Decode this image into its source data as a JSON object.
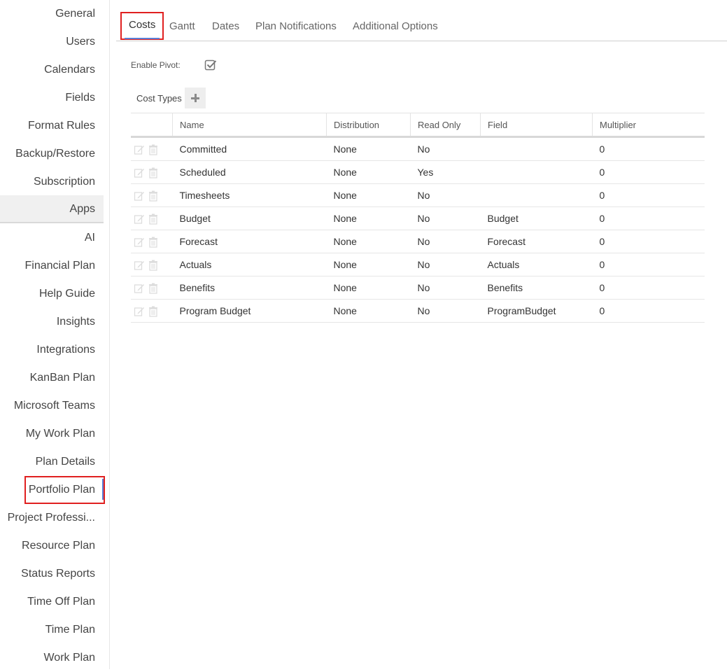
{
  "sidebar": {
    "items": [
      {
        "label": "General"
      },
      {
        "label": "Users"
      },
      {
        "label": "Calendars"
      },
      {
        "label": "Fields"
      },
      {
        "label": "Format Rules"
      },
      {
        "label": "Backup/Restore"
      },
      {
        "label": "Subscription"
      },
      {
        "label": "Apps"
      },
      {
        "label": "AI"
      },
      {
        "label": "Financial Plan"
      },
      {
        "label": "Help Guide"
      },
      {
        "label": "Insights"
      },
      {
        "label": "Integrations"
      },
      {
        "label": "KanBan Plan"
      },
      {
        "label": "Microsoft Teams"
      },
      {
        "label": "My Work Plan"
      },
      {
        "label": "Plan Details"
      },
      {
        "label": "Portfolio Plan"
      },
      {
        "label": "Project Professi..."
      },
      {
        "label": "Resource Plan"
      },
      {
        "label": "Status Reports"
      },
      {
        "label": "Time Off Plan"
      },
      {
        "label": "Time Plan"
      },
      {
        "label": "Work Plan"
      }
    ]
  },
  "tabs": [
    {
      "label": "Costs"
    },
    {
      "label": "Gantt"
    },
    {
      "label": "Dates"
    },
    {
      "label": "Plan Notifications"
    },
    {
      "label": "Additional Options"
    }
  ],
  "pivot": {
    "label": "Enable Pivot:",
    "checked": true
  },
  "cost_types": {
    "label": "Cost Types",
    "columns": [
      "Name",
      "Distribution",
      "Read Only",
      "Field",
      "Multiplier"
    ],
    "rows": [
      {
        "name": "Committed",
        "distribution": "None",
        "read_only": "No",
        "field": "",
        "multiplier": "0"
      },
      {
        "name": "Scheduled",
        "distribution": "None",
        "read_only": "Yes",
        "field": "",
        "multiplier": "0"
      },
      {
        "name": "Timesheets",
        "distribution": "None",
        "read_only": "No",
        "field": "",
        "multiplier": "0"
      },
      {
        "name": "Budget",
        "distribution": "None",
        "read_only": "No",
        "field": "Budget",
        "multiplier": "0"
      },
      {
        "name": "Forecast",
        "distribution": "None",
        "read_only": "No",
        "field": "Forecast",
        "multiplier": "0"
      },
      {
        "name": "Actuals",
        "distribution": "None",
        "read_only": "No",
        "field": "Actuals",
        "multiplier": "0"
      },
      {
        "name": "Benefits",
        "distribution": "None",
        "read_only": "No",
        "field": "Benefits",
        "multiplier": "0"
      },
      {
        "name": "Program Budget",
        "distribution": "None",
        "read_only": "No",
        "field": "ProgramBudget",
        "multiplier": "0"
      }
    ]
  },
  "colors": {
    "highlight": "#e02020",
    "accent": "#5b7fd6"
  }
}
